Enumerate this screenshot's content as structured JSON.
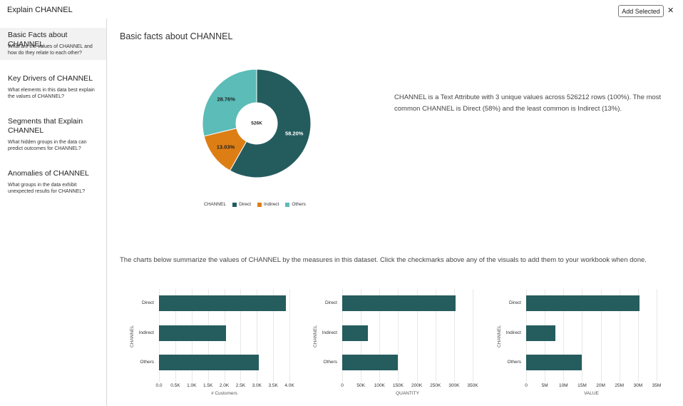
{
  "window": {
    "title": "Explain CHANNEL",
    "add_selected": "Add Selected",
    "close": "✕"
  },
  "sidebar": {
    "items": [
      {
        "title": "Basic Facts about CHANNEL",
        "desc": "What are the values of CHANNEL and how do they relate to each other?",
        "active": true
      },
      {
        "title": "Key Drivers of CHANNEL",
        "desc": "What elements in this data best explain the values of CHANNEL?"
      },
      {
        "title": "Segments that Explain CHANNEL",
        "desc": "What hidden groups in the data can predict outcomes for CHANNEL?"
      },
      {
        "title": "Anomalies of CHANNEL",
        "desc": "What groups in the data exhibit unexpected results for CHANNEL?"
      }
    ]
  },
  "main": {
    "heading": "Basic facts about CHANNEL",
    "description": "CHANNEL is a Text Attribute with 3 unique values across 526212 rows (100%). The most common CHANNEL is Direct (58%) and the least common is Indirect (13%).",
    "summary": "The charts below summarize the values of CHANNEL by the measures in this dataset. Click the checkmarks above any of the visuals to add them to your workbook when done."
  },
  "colors": {
    "direct": "#245c5e",
    "indirect": "#dd7e15",
    "others": "#5bbcb8"
  },
  "chart_data": [
    {
      "type": "pie",
      "center_label": "526K",
      "legend_title": "CHANNEL",
      "categories": [
        "Direct",
        "Indirect",
        "Others"
      ],
      "values": [
        58.2,
        13.03,
        28.76
      ],
      "labels": [
        "58.20%",
        "13.03%",
        "28.76%"
      ],
      "donut": true
    },
    {
      "type": "bar",
      "categories": [
        "Direct",
        "Indirect",
        "Others"
      ],
      "values": [
        3900,
        2050,
        3050
      ],
      "xlabel": "# Customers",
      "ylabel": "CHANNEL",
      "xlim": [
        0,
        4000
      ],
      "ticks": [
        "0.0",
        "0.5K",
        "1.0K",
        "1.5K",
        "2.0K",
        "2.5K",
        "3.0K",
        "3.5K",
        "4.0K"
      ]
    },
    {
      "type": "bar",
      "categories": [
        "Direct",
        "Indirect",
        "Others"
      ],
      "values": [
        305000,
        68000,
        150000
      ],
      "xlabel": "QUANTITY",
      "ylabel": "CHANNEL",
      "xlim": [
        0,
        350000
      ],
      "ticks": [
        "0",
        "50K",
        "100K",
        "150K",
        "200K",
        "250K",
        "300K",
        "350K"
      ]
    },
    {
      "type": "bar",
      "categories": [
        "Direct",
        "Indirect",
        "Others"
      ],
      "values": [
        30500000,
        7800000,
        15000000
      ],
      "xlabel": "VALUE",
      "ylabel": "CHANNEL",
      "xlim": [
        0,
        35000000
      ],
      "ticks": [
        "0",
        "5M",
        "10M",
        "15M",
        "20M",
        "25M",
        "30M",
        "35M"
      ]
    }
  ]
}
